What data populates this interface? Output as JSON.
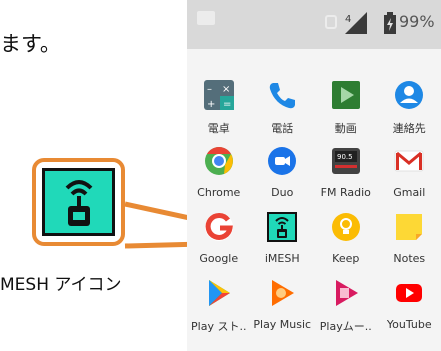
{
  "annotation": {
    "top_text": "ます。",
    "bottom_text": "MESH アイコン"
  },
  "callout": {
    "icon": "imesh-icon",
    "border_color": "#e88a34",
    "icon_bg": "#20d9b9"
  },
  "status_bar": {
    "battery_percent": "99%",
    "icons": [
      "notification-icon",
      "vibrate-icon",
      "signal-icon",
      "battery-icon"
    ]
  },
  "apps": [
    {
      "label": "電卓",
      "icon": "calculator-icon",
      "color": "#546e7a"
    },
    {
      "label": "電話",
      "icon": "phone-icon",
      "color": "#1e88e5"
    },
    {
      "label": "動画",
      "icon": "video-play-icon",
      "color": "#2e7d32"
    },
    {
      "label": "連絡先",
      "icon": "contacts-icon",
      "color": "#1e88e5"
    },
    {
      "label": "Chrome",
      "icon": "chrome-icon",
      "color": "#4285f4"
    },
    {
      "label": "Duo",
      "icon": "duo-icon",
      "color": "#1a73e8"
    },
    {
      "label": "FM Radio",
      "icon": "fm-radio-icon",
      "color": "#424242"
    },
    {
      "label": "Gmail",
      "icon": "gmail-icon",
      "color": "#d93025"
    },
    {
      "label": "Google",
      "icon": "google-icon",
      "color": "#ea4335"
    },
    {
      "label": "iMESH",
      "icon": "imesh-icon",
      "color": "#20d9b9"
    },
    {
      "label": "Keep",
      "icon": "keep-icon",
      "color": "#fbbc04"
    },
    {
      "label": "Notes",
      "icon": "notes-icon",
      "color": "#fdd835"
    },
    {
      "label": "Play スト..",
      "icon": "play-store-icon",
      "color": "#00c853"
    },
    {
      "label": "Play Music",
      "icon": "play-music-icon",
      "color": "#ff6d00"
    },
    {
      "label": "Playムー..",
      "icon": "play-movies-icon",
      "color": "#d81b60"
    },
    {
      "label": "YouTube",
      "icon": "youtube-icon",
      "color": "#ff0000"
    }
  ]
}
